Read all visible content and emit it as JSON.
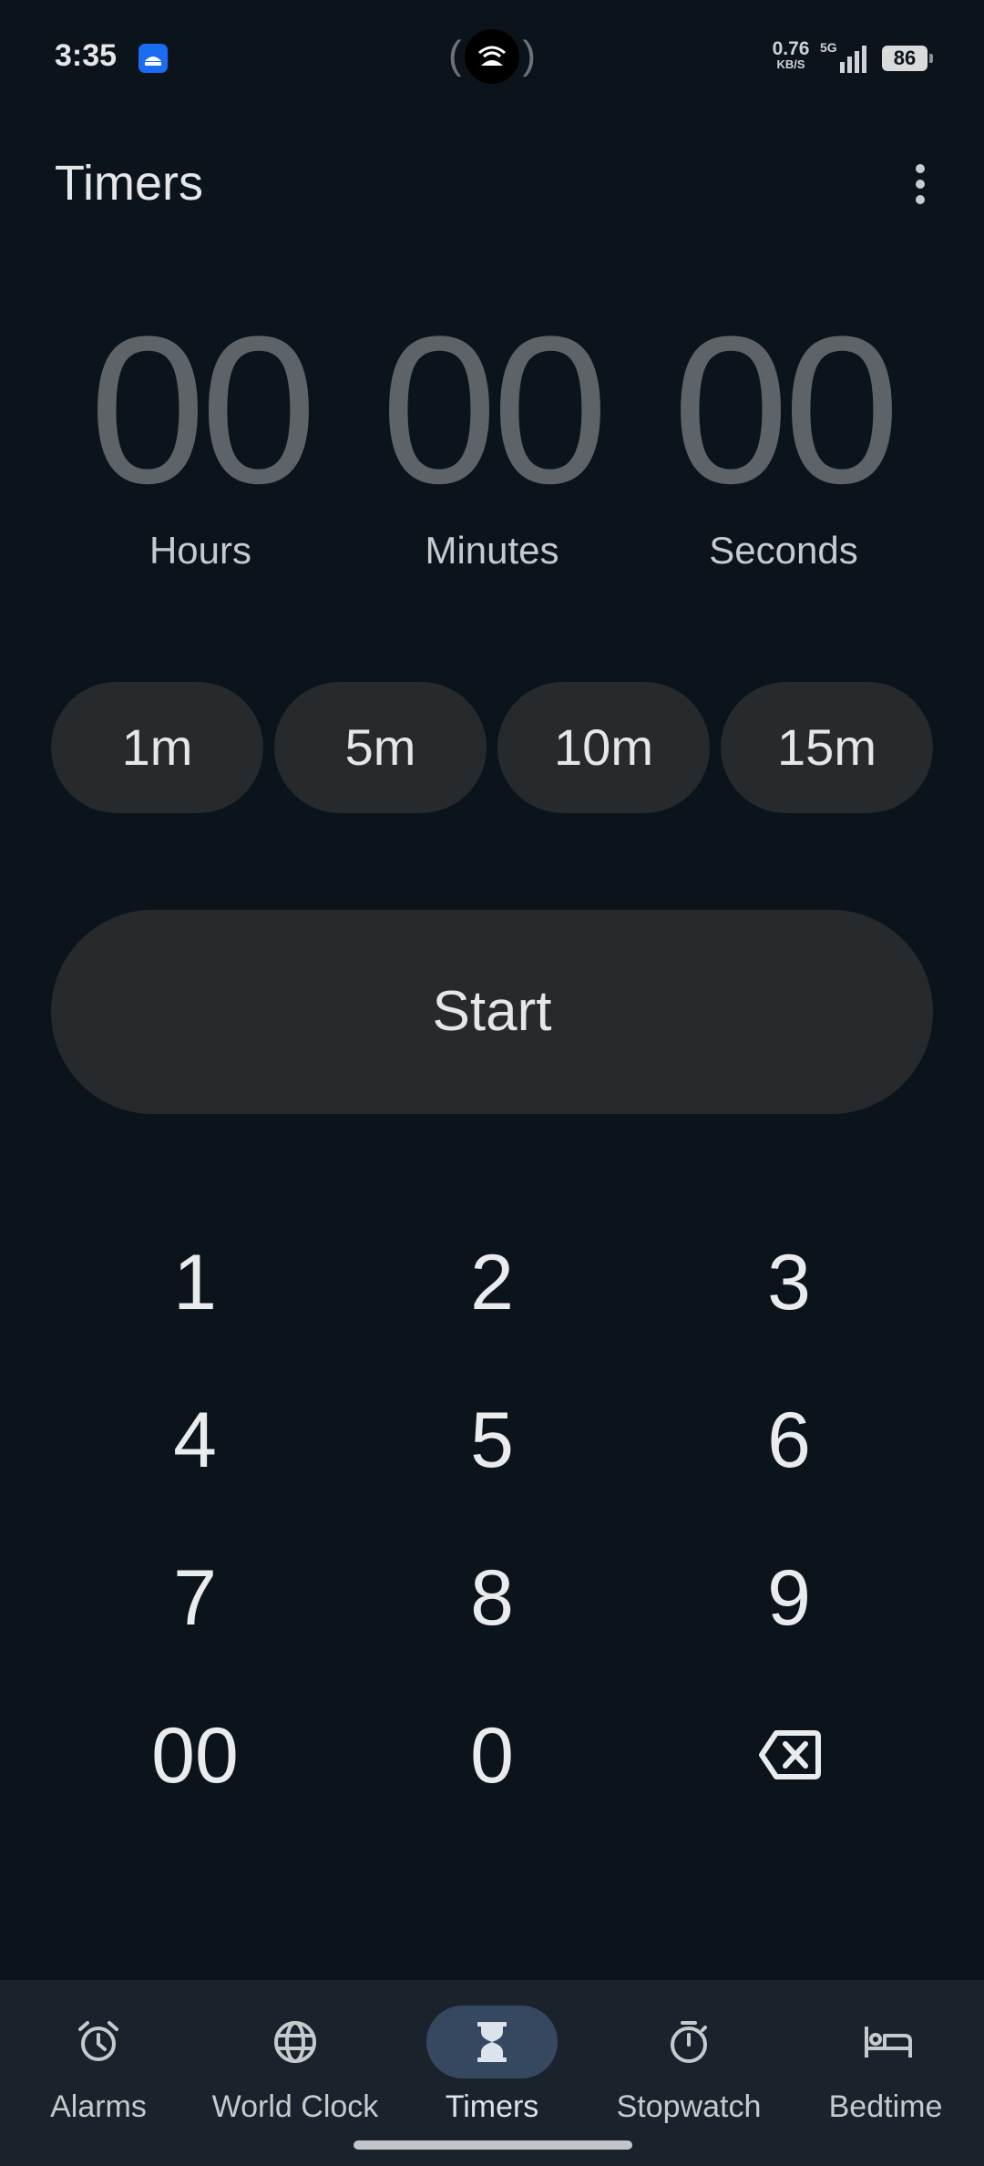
{
  "status_bar": {
    "time": "3:35",
    "speed_value": "0.76",
    "speed_unit": "KB/S",
    "network": "5G",
    "battery": "86"
  },
  "header": {
    "title": "Timers"
  },
  "timer_display": {
    "hours_value": "00",
    "hours_label": "Hours",
    "minutes_value": "00",
    "minutes_label": "Minutes",
    "seconds_value": "00",
    "seconds_label": "Seconds"
  },
  "presets": [
    "1m",
    "5m",
    "10m",
    "15m"
  ],
  "start_label": "Start",
  "keypad": {
    "keys": [
      "1",
      "2",
      "3",
      "4",
      "5",
      "6",
      "7",
      "8",
      "9",
      "00",
      "0"
    ],
    "backspace_icon": "backspace-icon"
  },
  "bottom_nav": {
    "items": [
      {
        "label": "Alarms",
        "icon": "alarm-clock-icon"
      },
      {
        "label": "World Clock",
        "icon": "globe-icon"
      },
      {
        "label": "Timers",
        "icon": "hourglass-icon",
        "active": true
      },
      {
        "label": "Stopwatch",
        "icon": "stopwatch-icon"
      },
      {
        "label": "Bedtime",
        "icon": "bed-icon"
      }
    ]
  },
  "colors": {
    "background": "#0c141b",
    "chip": "#272a2c",
    "nav_bar": "#1a232b",
    "active_indicator": "#364860",
    "digits_idle": "#5d6367"
  }
}
